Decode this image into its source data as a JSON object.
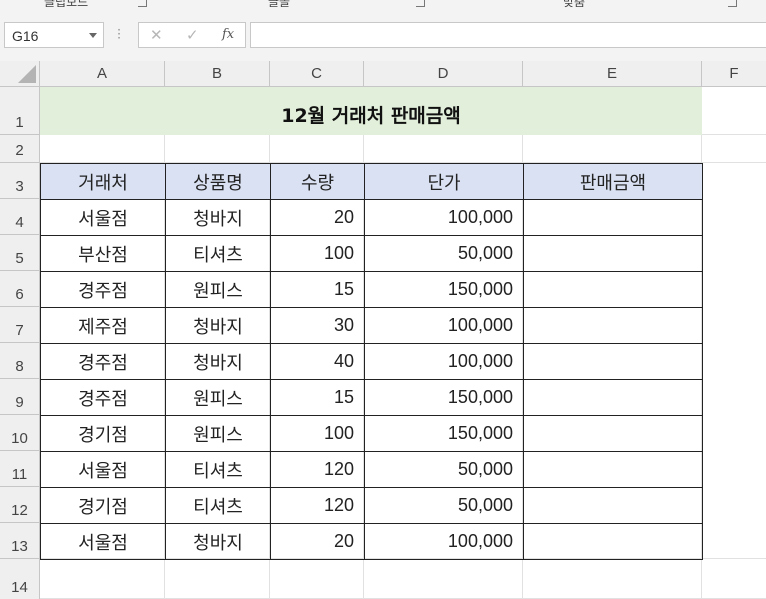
{
  "ribbon": {
    "groups": [
      "클립보드",
      "글꼴",
      "맞춤"
    ]
  },
  "formula_bar": {
    "name_box": "G16",
    "cancel_icon": "✕",
    "enter_icon": "✓",
    "fx_label": "fx",
    "formula": ""
  },
  "columns": [
    "A",
    "B",
    "C",
    "D",
    "E",
    "F"
  ],
  "rows": [
    "1",
    "2",
    "3",
    "4",
    "5",
    "6",
    "7",
    "8",
    "9",
    "10",
    "11",
    "12",
    "13",
    "14"
  ],
  "sheet": {
    "title": "12월 거래처 판매금액",
    "title_fill": "#e2efda",
    "header_fill": "#d9e1f2",
    "headers": [
      "거래처",
      "상품명",
      "수량",
      "단가",
      "판매금액"
    ],
    "records": [
      [
        "서울점",
        "청바지",
        "20",
        "100,000",
        ""
      ],
      [
        "부산점",
        "티셔츠",
        "100",
        "50,000",
        ""
      ],
      [
        "경주점",
        "원피스",
        "15",
        "150,000",
        ""
      ],
      [
        "제주점",
        "청바지",
        "30",
        "100,000",
        ""
      ],
      [
        "경주점",
        "청바지",
        "40",
        "100,000",
        ""
      ],
      [
        "경주점",
        "원피스",
        "15",
        "150,000",
        ""
      ],
      [
        "경기점",
        "원피스",
        "100",
        "150,000",
        ""
      ],
      [
        "서울점",
        "티셔츠",
        "120",
        "50,000",
        ""
      ],
      [
        "경기점",
        "티셔츠",
        "120",
        "50,000",
        ""
      ],
      [
        "서울점",
        "청바지",
        "20",
        "100,000",
        ""
      ]
    ]
  }
}
